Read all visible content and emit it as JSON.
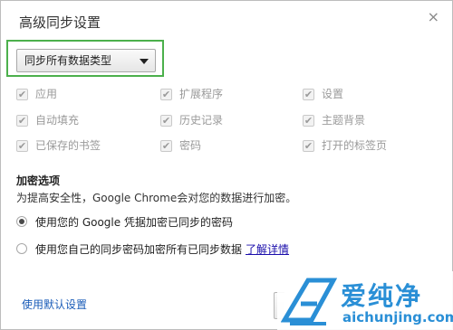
{
  "dialog": {
    "title": "高级同步设置",
    "close_glyph": "×"
  },
  "sync_select": {
    "value": "同步所有数据类型"
  },
  "data_types": [
    {
      "label": "应用",
      "checked": true
    },
    {
      "label": "扩展程序",
      "checked": true
    },
    {
      "label": "设置",
      "checked": true
    },
    {
      "label": "自动填充",
      "checked": true
    },
    {
      "label": "历史记录",
      "checked": true
    },
    {
      "label": "主题背景",
      "checked": true
    },
    {
      "label": "已保存的书签",
      "checked": true
    },
    {
      "label": "密码",
      "checked": true
    },
    {
      "label": "打开的标签页",
      "checked": true
    }
  ],
  "encryption": {
    "title": "加密选项",
    "description": "为提高安全性，Google Chrome会对您的数据进行加密。",
    "option1": "使用您的 Google 凭据加密已同步的密码",
    "option2": "使用您自己的同步密码加密所有已同步数据",
    "learn_more": "了解详情"
  },
  "footer": {
    "default_link": "使用默认设置"
  },
  "watermark": {
    "cn": "爱纯净",
    "url": "aichunjing.com"
  },
  "colors": {
    "highlight": "#4cb04c",
    "watermark": "#2a8fd6",
    "link": "#1a0dab"
  }
}
